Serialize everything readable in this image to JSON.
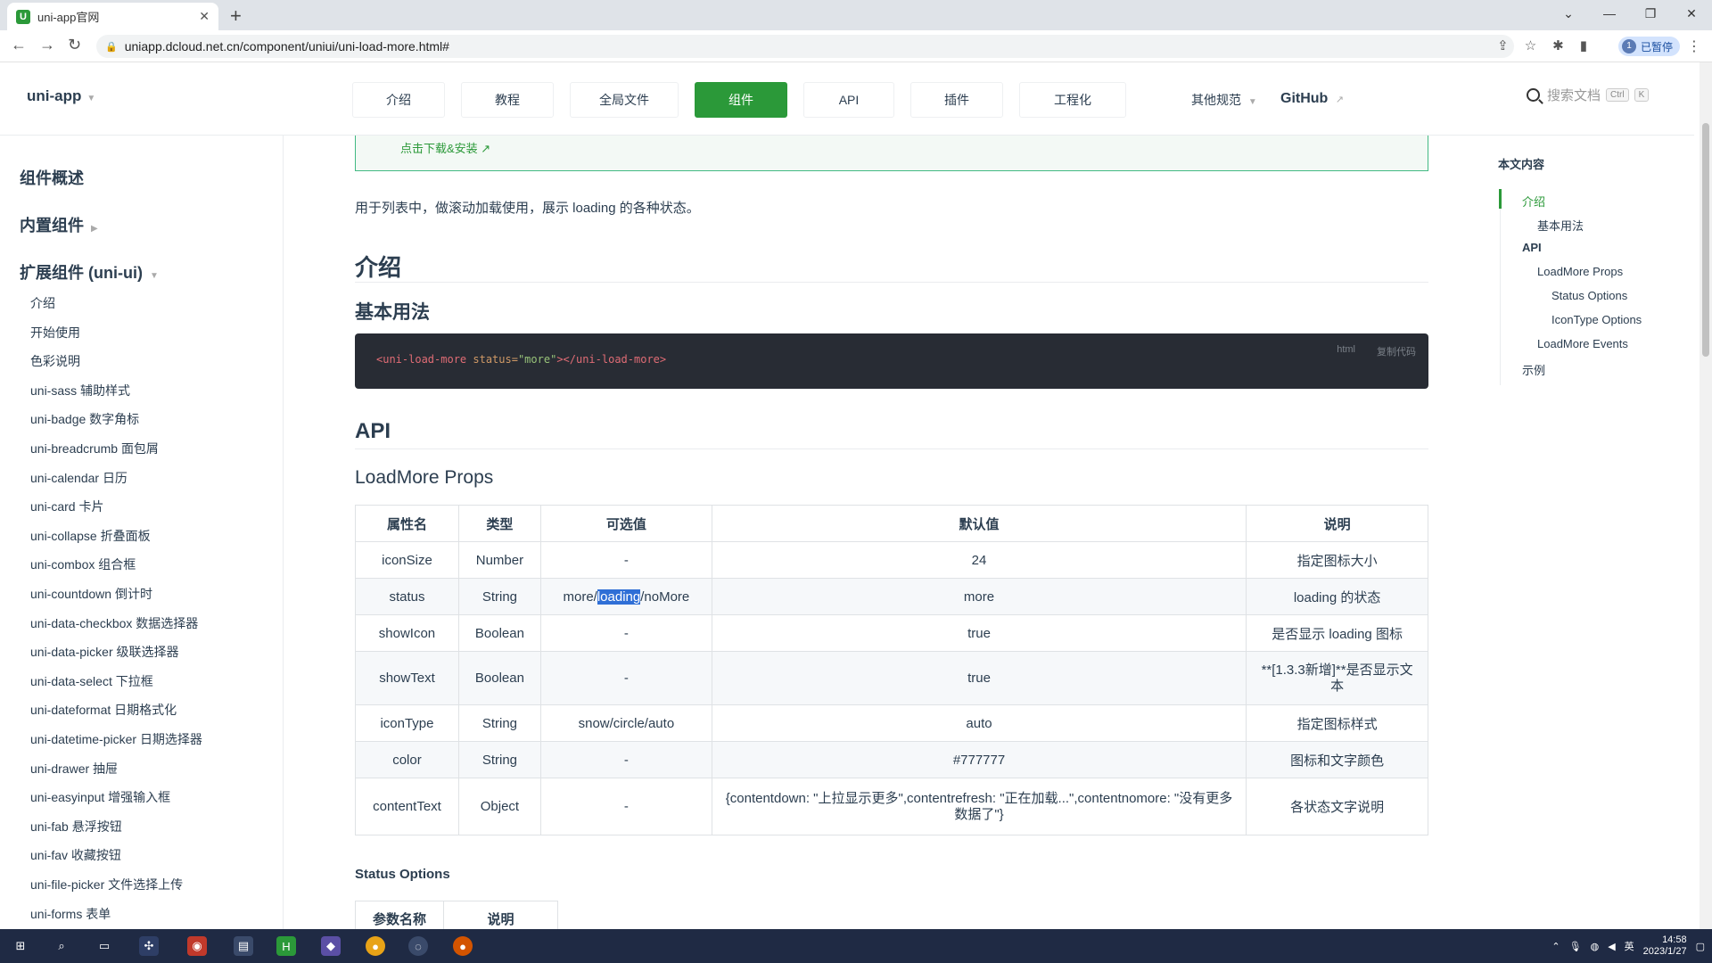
{
  "browser": {
    "tab_title": "uni-app官网",
    "url": "uniapp.dcloud.net.cn/component/uniui/uni-load-more.html#",
    "profile_label": "已暂停",
    "profile_initial": "1"
  },
  "header": {
    "logo": "uni-app",
    "nav": [
      "介绍",
      "教程",
      "全局文件",
      "组件",
      "API",
      "插件",
      "工程化"
    ],
    "active_nav": "组件",
    "other_label": "其他规范",
    "github_label": "GitHub",
    "search_placeholder": "搜索文档",
    "search_keys": [
      "Ctrl",
      "K"
    ]
  },
  "sidebar": {
    "sections": [
      "组件概述",
      "内置组件",
      "扩展组件 (uni-ui)"
    ],
    "items": [
      "介绍",
      "开始使用",
      "色彩说明",
      "uni-sass 辅助样式",
      "uni-badge 数字角标",
      "uni-breadcrumb 面包屑",
      "uni-calendar 日历",
      "uni-card 卡片",
      "uni-collapse 折叠面板",
      "uni-combox 组合框",
      "uni-countdown 倒计时",
      "uni-data-checkbox 数据选择器",
      "uni-data-picker 级联选择器",
      "uni-data-select 下拉框",
      "uni-dateformat 日期格式化",
      "uni-datetime-picker 日期选择器",
      "uni-drawer 抽屉",
      "uni-easyinput 增强输入框",
      "uni-fab 悬浮按钮",
      "uni-fav 收藏按钮",
      "uni-file-picker 文件选择上传",
      "uni-forms 表单"
    ]
  },
  "main": {
    "download_link": "点击下载&安装",
    "intro_text": "用于列表中，做滚动加载使用，展示 loading 的各种状态。",
    "h_intro": "介绍",
    "h_basic": "基本用法",
    "code": {
      "tag_open": "<uni-load-more",
      "attr": " status=",
      "value": "\"more\"",
      "close": "></uni-load-more>",
      "lang": "html",
      "copy": "复制代码"
    },
    "h_api": "API",
    "h_props": "LoadMore Props",
    "props_headers": [
      "属性名",
      "类型",
      "可选值",
      "默认值",
      "说明"
    ],
    "props_rows": [
      [
        "iconSize",
        "Number",
        "-",
        "24",
        "指定图标大小"
      ],
      [
        "status",
        "String",
        "more/loading/noMore",
        "more",
        "loading 的状态"
      ],
      [
        "showIcon",
        "Boolean",
        "-",
        "true",
        "是否显示 loading 图标"
      ],
      [
        "showText",
        "Boolean",
        "-",
        "true",
        "**[1.3.3新增]**是否显示文本"
      ],
      [
        "iconType",
        "String",
        "snow/circle/auto",
        "auto",
        "指定图标样式"
      ],
      [
        "color",
        "String",
        "-",
        "#777777",
        "图标和文字颜色"
      ],
      [
        "contentText",
        "Object",
        "-",
        "{contentdown: \"上拉显示更多\",contentrefresh: \"正在加载...\",contentnomore: \"没有更多数据了\"}",
        "各状态文字说明"
      ]
    ],
    "status_options_label": "Status Options",
    "status_headers": [
      "参数名称",
      "说明"
    ]
  },
  "toc": {
    "title": "本文内容",
    "items": [
      "介绍",
      "基本用法",
      "API",
      "LoadMore Props",
      "Status Options",
      "IconType Options",
      "LoadMore Events",
      "示例"
    ]
  },
  "taskbar": {
    "time": "14:58",
    "date": "2023/1/27",
    "lang": "英"
  },
  "colors": {
    "accent": "#2b9939",
    "selection": "#2f6fd6",
    "code_bg": "#282c34"
  }
}
